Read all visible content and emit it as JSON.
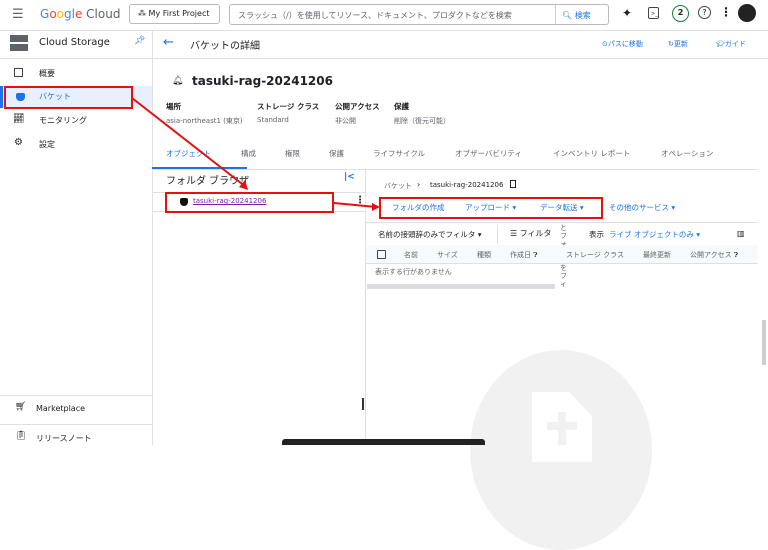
{
  "header": {
    "logo": "Google Cloud",
    "project": "My First Project",
    "search_placeholder": "スラッシュ（/）を使用してリソース、ドキュメント、プロダクトなどを検索",
    "search_button": "検索",
    "notifications": "2"
  },
  "sidebar": {
    "title": "Cloud Storage",
    "items": [
      {
        "label": "概要"
      },
      {
        "label": "バケット"
      },
      {
        "label": "モニタリング"
      },
      {
        "label": "設定"
      }
    ],
    "bottom": [
      {
        "label": "Marketplace"
      },
      {
        "label": "リリースノート"
      }
    ]
  },
  "page": {
    "title": "バケットの詳細",
    "actions": [
      "パスに移動",
      "更新",
      "ガイド"
    ],
    "bucket_name": "tasuki-rag-20241206",
    "info": [
      {
        "label": "場所",
        "value": "asia-northeast1 (東京)"
      },
      {
        "label": "ストレージ クラス",
        "value": "Standard"
      },
      {
        "label": "公開アクセス",
        "value": "非公開"
      },
      {
        "label": "保護",
        "value": "削除（復元可能）"
      }
    ],
    "tabs": [
      "オブジェクト",
      "構成",
      "権限",
      "保護",
      "ライフサイクル",
      "オブザーバビリティ",
      "インベントリ レポート",
      "オペレーション"
    ]
  },
  "folder_browser": {
    "title": "フォルダ ブラウザ",
    "item": "tasuki-rag-20241206"
  },
  "objects": {
    "breadcrumb_root": "バケット",
    "breadcrumb_current": "tasuki-rag-20241206",
    "buttons": [
      "フォルダの作成",
      "アップロード",
      "データ転送",
      "その他のサービス"
    ],
    "filter_prefix": "名前の接頭辞のみでフィルタ",
    "filter": "フィルタ",
    "tooltip": "とフォルダをフィ",
    "show_label": "表示",
    "show_value": "ライブ オブジェクトのみ",
    "columns": [
      "名前",
      "サイズ",
      "種類",
      "作成日",
      "ストレージ クラス",
      "最終更新",
      "公開アクセス"
    ],
    "empty": "表示する行がありません"
  }
}
